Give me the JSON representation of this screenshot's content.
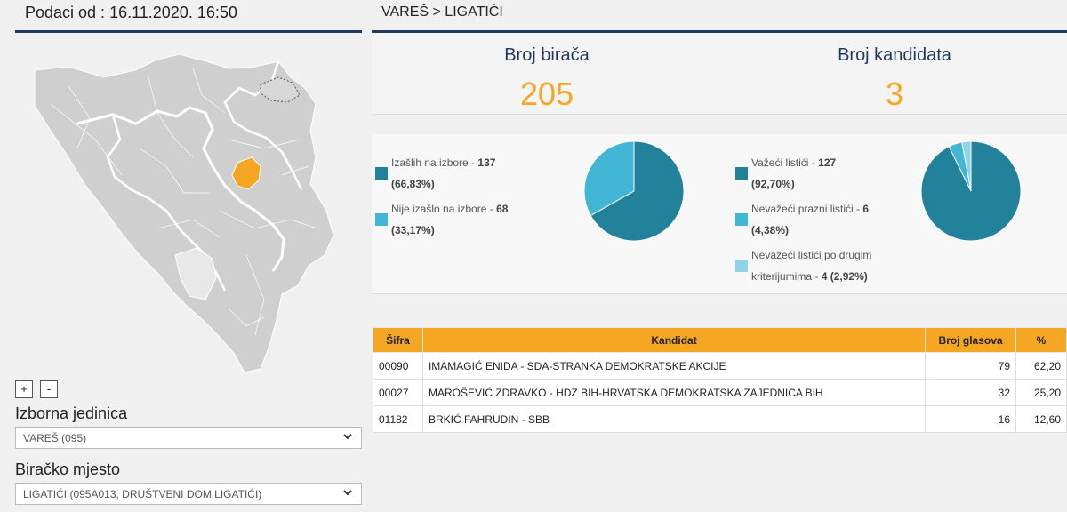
{
  "left_panel": {
    "datetime": "Podaci od : 16.11.2020. 16:50",
    "zoom_in": "+",
    "zoom_out": "-",
    "izborna_jedinica_label": "Izborna jedinica",
    "izborna_jedinica_value": "VAREŠ (095)",
    "biracko_mjesto_label": "Biračko mjesto",
    "biracko_mjesto_value": "LIGATIĆI (095A013, DRUŠTVENI DOM LIGATIĆI)"
  },
  "breadcrumb": "VAREŠ > LIGATIĆI",
  "stats": {
    "voters_label": "Broj birača",
    "voters_value": "205",
    "candidates_label": "Broj kandidata",
    "candidates_value": "3"
  },
  "turnout": {
    "items": [
      {
        "label": "Izašlih na izbore",
        "count": "137",
        "pct": "(66,83%)",
        "color": "#23829b",
        "value": 137
      },
      {
        "label": "Nije izašlo na izbore",
        "count": "68",
        "pct": "(33,17%)",
        "color": "#41b6d5",
        "value": 68
      }
    ]
  },
  "ballots": {
    "items": [
      {
        "label": "Važeći listići",
        "count": "127",
        "pct": "(92,70%)",
        "color": "#23829b",
        "value": 127
      },
      {
        "label": "Nevažeći prazni listići",
        "count": "6",
        "pct": "(4,38%)",
        "color": "#41b6d5",
        "value": 6
      },
      {
        "label": "Nevažeći listići po drugim kriterijumima",
        "count": "4",
        "pct": "(2,92%)",
        "color": "#8fd4e6",
        "value": 4
      }
    ]
  },
  "table": {
    "headers": {
      "code": "Šifra",
      "candidate": "Kandidat",
      "votes": "Broj glasova",
      "pct": "%"
    },
    "rows": [
      {
        "code": "00090",
        "candidate": "IMAMAGIĆ ENIDA - SDA-STRANKA DEMOKRATSKE AKCIJE",
        "votes": "79",
        "pct": "62,20"
      },
      {
        "code": "00027",
        "candidate": "MAROŠEVIĆ ZDRAVKO - HDZ BIH-HRVATSKA DEMOKRATSKA ZAJEDNICA BIH",
        "votes": "32",
        "pct": "25,20"
      },
      {
        "code": "01182",
        "candidate": "BRKIĆ FAHRUDIN - SBB",
        "votes": "16",
        "pct": "12,60"
      }
    ]
  },
  "colors": {
    "accent": "#f5a623",
    "navy": "#1f3a5f",
    "teal": "#23829b",
    "light_blue": "#41b6d5",
    "pale_blue": "#8fd4e6",
    "selected_region": "#f5a623"
  },
  "icons": {
    "dropdown": "chevron-down-icon"
  }
}
